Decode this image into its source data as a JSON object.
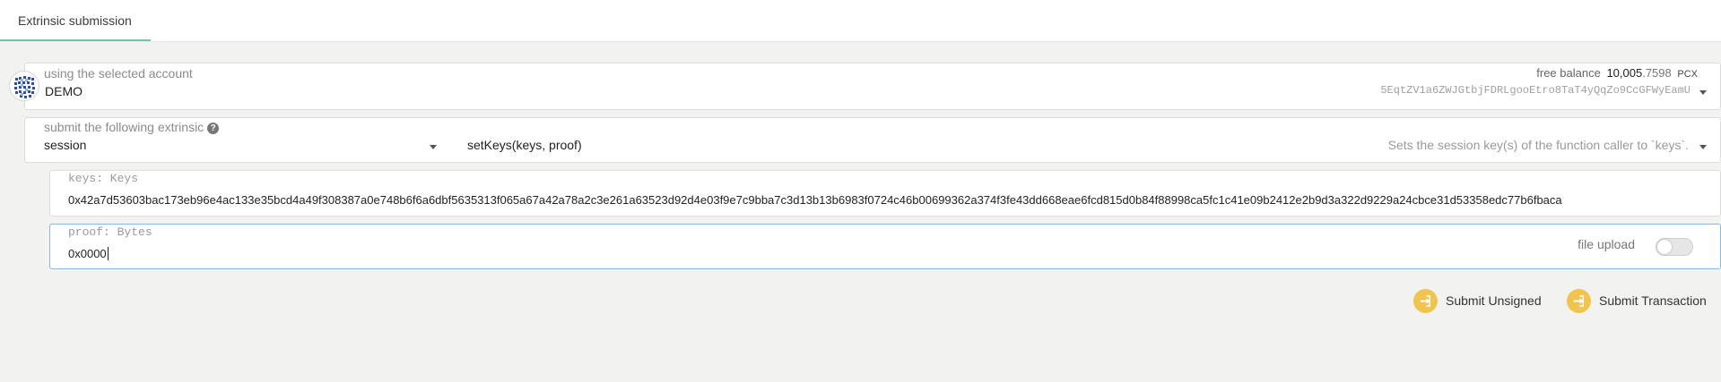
{
  "tabs": [
    {
      "label": "Extrinsic submission",
      "active": true
    }
  ],
  "account": {
    "label": "using the selected account",
    "name": "DEMO",
    "balance_label": "free balance",
    "balance_whole": "10,005",
    "balance_decimal": ".7598",
    "balance_unit": "PCX",
    "address": "5EqtZV1a6ZWJGtbjFDRLgooEtro8TaT4yQqZo9CcGFWyEamU"
  },
  "extrinsic": {
    "label": "submit the following extrinsic",
    "help_icon": "question-circle-icon",
    "module": "session",
    "method": "setKeys(keys, proof)",
    "description": "Sets the session key(s) of the function caller to `keys`."
  },
  "params": [
    {
      "label": "keys: Keys",
      "value": "0x42a7d53603bac173eb96e4ac133e35bcd4a49f308387a0e748b6f6a6dbf5635313f065a67a42a78a2c3e261a63523d92d4e03f9e7c9bba7c3d13b13b6983f0724c46b00699362a374f3fe43dd668eae6fcd815d0b84f88998ca5fc1c41e09b2412e2b9d3a322d9229a24cbce31d53358edc77b6fbaca"
    },
    {
      "label": "proof: Bytes",
      "value": "0x0000",
      "file_upload_label": "file upload",
      "file_upload_enabled": false
    }
  ],
  "actions": {
    "unsigned_label": "Submit Unsigned",
    "transaction_label": "Submit Transaction",
    "accent": "#f1c44f"
  }
}
